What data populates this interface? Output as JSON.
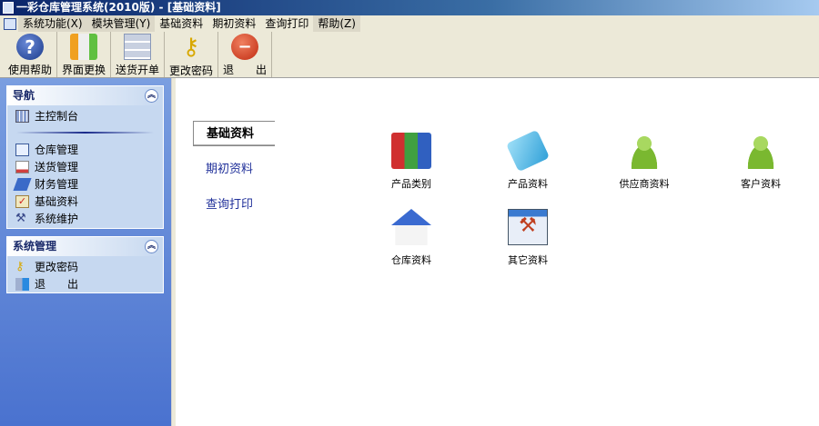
{
  "window": {
    "title": "一彩仓库管理系统(2010版) - [基础资料]"
  },
  "menu": [
    "系统功能(X)",
    "模块管理(Y)",
    "基础资料",
    "期初资料",
    "查询打印",
    "帮助(Z)"
  ],
  "toolbar": [
    {
      "label": "使用帮助",
      "icon": "help-icon"
    },
    {
      "label": "界面更换",
      "icon": "switch-icon"
    },
    {
      "label": "送货开单",
      "icon": "list-icon"
    },
    {
      "label": "更改密码",
      "icon": "key-icon"
    },
    {
      "label": "退　　出",
      "icon": "exit-icon"
    }
  ],
  "nav": {
    "title": "导航",
    "items": [
      "主控制台",
      "仓库管理",
      "送货管理",
      "财务管理",
      "基础资料",
      "系统维护"
    ]
  },
  "sys": {
    "title": "系统管理",
    "items": [
      "更改密码",
      "退　　出"
    ]
  },
  "tabs": [
    "基础资料",
    "期初资料",
    "查询打印"
  ],
  "modules": [
    "产品类别",
    "产品资料",
    "供应商资料",
    "客户资料",
    "仓库资料",
    "其它资料"
  ]
}
